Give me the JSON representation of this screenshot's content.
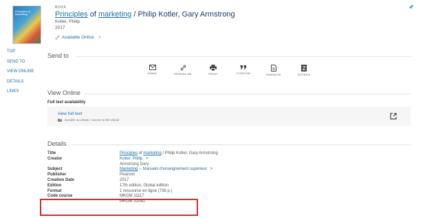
{
  "record": {
    "type": "BOOK",
    "title_part1": "Principles",
    "title_of": " of ",
    "title_part2": "marketing",
    "title_rest": " / Philip Kotler, Gary Armstrong",
    "author": "Kotler, Philip",
    "year": "2017",
    "availability": "Available Online",
    "cover_text": "Principles of Marketing"
  },
  "nav": [
    "TOP",
    "SEND TO",
    "VIEW ONLINE",
    "DETAILS",
    "LINKS"
  ],
  "send_to": {
    "heading": "Send to",
    "actions": [
      {
        "label": "EMAIL",
        "icon": "email-icon"
      },
      {
        "label": "PERMALINK",
        "icon": "link-icon"
      },
      {
        "label": "PRINT",
        "icon": "print-icon"
      },
      {
        "label": "CITATION",
        "icon": "quote-icon"
      },
      {
        "label": "ENDNOTE",
        "icon": "document-icon"
      },
      {
        "label": "ZOTERO",
        "icon": "zotero-icon"
      }
    ]
  },
  "view_online": {
    "heading": "View Online",
    "availability_label": "Full text availability",
    "link": "view full text",
    "note": "Accéder au ebook / Access to the ebook"
  },
  "details": {
    "heading": "Details",
    "title_label": "Title",
    "title_p1": "Principles",
    "title_of": " of ",
    "title_p2": "marketing",
    "title_rest": " / Philip Kotler, Gary Armstrong",
    "creator_label": "Creator",
    "creator1": "Kotler, Philip",
    "creator2": "Armstrong Gary",
    "subject_label": "Subject",
    "subject_p1": "Marketing",
    "subject_rest": " -- Manuels d'enseignement supérieur",
    "publisher_label": "Publisher",
    "publisher": "Pearson",
    "date_label": "Creation Date",
    "date": "2017",
    "edition_label": "Edition",
    "edition": "17th edition, Global edition",
    "format_label": "Format",
    "format": "1 ressource en ligne (736 p.)",
    "code_label": "Code course",
    "code1": "MKGM 11117",
    "code2": "MKGM 31081",
    "chevron": ">"
  }
}
